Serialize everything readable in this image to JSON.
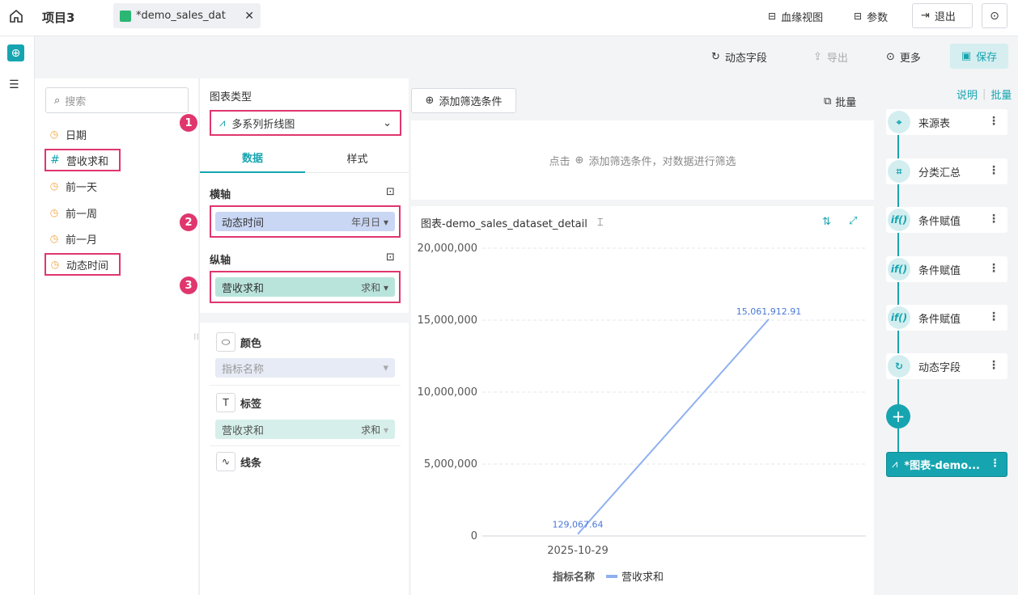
{
  "topbar": {
    "project_title": "项目3",
    "tab_label": "*demo_sales_dat",
    "lineage_label": "血缘视图",
    "params_label": "参数",
    "exit_label": "退出"
  },
  "toolbar": {
    "dynamic_field": "动态字段",
    "export": "导出",
    "more": "更多",
    "save": "保存"
  },
  "fields": {
    "search_placeholder": "搜索",
    "items": [
      "日期",
      "营收求和",
      "前一天",
      "前一周",
      "前一月",
      "动态时间"
    ]
  },
  "config": {
    "chart_type_label": "图表类型",
    "chart_type_value": "多系列折线图",
    "tab_data": "数据",
    "tab_style": "样式",
    "x_axis_label": "横轴",
    "x_field": "动态时间",
    "x_field_agg": "年月日",
    "y_axis_label": "纵轴",
    "y_field": "营收求和",
    "y_field_agg": "求和",
    "color_label": "颜色",
    "color_value": "指标名称",
    "tag_label": "标签",
    "tag_value": "营收求和",
    "tag_agg": "求和",
    "line_label": "线条",
    "badges": [
      "1",
      "2",
      "3"
    ]
  },
  "filter": {
    "add_button": "添加筛选条件",
    "batch": "批量",
    "hint_prefix": "点击",
    "hint_text": "添加筛选条件，对数据进行筛选"
  },
  "chart_data": {
    "type": "line",
    "title": "图表-demo_sales_dataset_detail",
    "categories": [
      "2025-10-29"
    ],
    "y_ticks": [
      "0",
      "5,000,000",
      "10,000,000",
      "15,000,000",
      "20,000,000"
    ],
    "ylim": [
      0,
      20000000
    ],
    "series": [
      {
        "name": "营收求和",
        "values": [
          129067.64,
          15061912.91
        ]
      }
    ],
    "data_labels": [
      "129,067.64",
      "15,061,912.91"
    ],
    "legend_title": "指标名称",
    "legend_position": "bottom",
    "color": "#8fb0f0",
    "grid": true
  },
  "flow": {
    "top_links": [
      "说明",
      "批量"
    ],
    "nodes": [
      "来源表",
      "分类汇总",
      "条件赋值",
      "条件赋值",
      "条件赋值",
      "动态字段"
    ],
    "active_node": "*图表-demo..."
  },
  "colors": {
    "accent": "#16a5b0",
    "highlight": "#e0366d",
    "x_pill": "#c9d6f4",
    "y_pill": "#b9e4dc"
  }
}
